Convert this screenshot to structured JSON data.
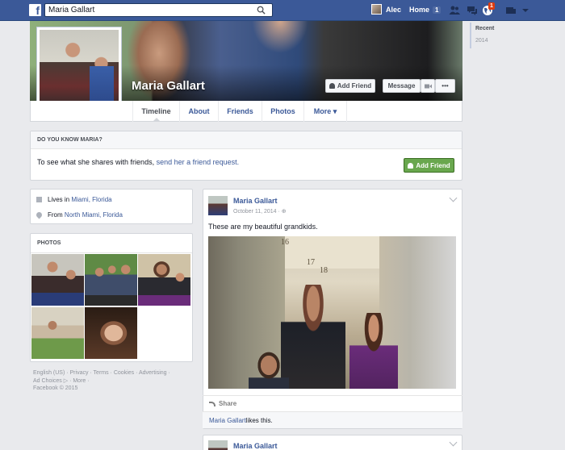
{
  "header": {
    "logo": "f",
    "search_value": "Maria Gallart",
    "user_name": "Alec",
    "home_label": "Home",
    "home_count": "1",
    "notification_count": "1"
  },
  "profile": {
    "name": "Maria Gallart",
    "add_friend_label": "Add Friend",
    "message_label": "Message",
    "more_label": "•••"
  },
  "tabs": [
    {
      "label": "Timeline"
    },
    {
      "label": "About"
    },
    {
      "label": "Friends"
    },
    {
      "label": "Photos"
    },
    {
      "label": "More ▾"
    }
  ],
  "scroller": {
    "items": [
      {
        "label": "Recent"
      },
      {
        "label": "2014"
      }
    ]
  },
  "know_box": {
    "heading": "DO YOU KNOW MARIA?",
    "text": "To see what she shares with friends, ",
    "link": "send her a friend request.",
    "button_label": "Add Friend"
  },
  "about": {
    "lives_prefix": "Lives in ",
    "lives_place": "Miami, Florida",
    "from_prefix": "From ",
    "from_place": "North Miami, Florida"
  },
  "photos": {
    "heading": "PHOTOS"
  },
  "footer": {
    "line1": "English (US) · Privacy · Terms · Cookies · Advertising ·",
    "line2": "Ad Choices ▷ · More ·",
    "line3": "Facebook © 2015"
  },
  "post": {
    "author": "Maria Gallart",
    "date": "October 11, 2014 · ⊕",
    "text": "These are my beautiful grandkids.",
    "photo_signs": [
      "16",
      "17",
      "18"
    ],
    "share_label": "Share",
    "likes_name": "Maria Gallart",
    "likes_suffix": " likes this."
  },
  "next_post": {
    "author": "Maria Gallart"
  }
}
